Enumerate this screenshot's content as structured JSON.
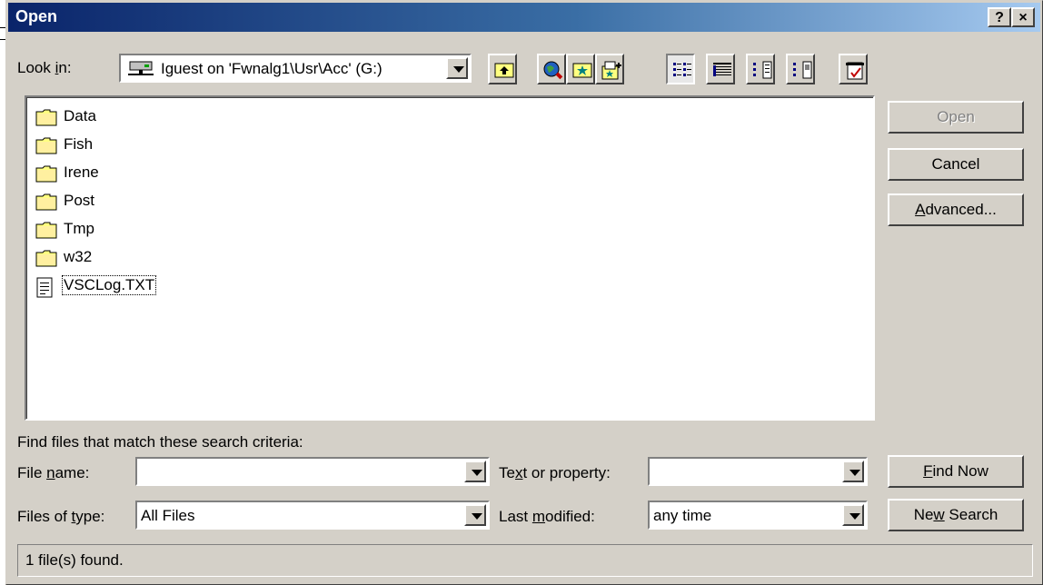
{
  "window": {
    "title": "Open",
    "help_label": "?",
    "close_label": "×"
  },
  "lookin": {
    "label_pre": "Look ",
    "label_accel": "i",
    "label_post": "n:",
    "value": "Iguest on 'Fwnalg1\\Usr\\Acc' (G:)"
  },
  "toolbar": [
    {
      "name": "up-one-level-icon"
    },
    {
      "name": "search-the-web-icon"
    },
    {
      "name": "look-in-favorites-icon"
    },
    {
      "name": "add-to-favorites-icon"
    },
    {
      "name": "list-view-icon"
    },
    {
      "name": "details-view-icon"
    },
    {
      "name": "properties-view-icon"
    },
    {
      "name": "preview-view-icon"
    },
    {
      "name": "commands-and-settings-icon"
    }
  ],
  "files": [
    {
      "name": "Data",
      "type": "folder"
    },
    {
      "name": "Fish",
      "type": "folder"
    },
    {
      "name": "Irene",
      "type": "folder"
    },
    {
      "name": "Post",
      "type": "folder"
    },
    {
      "name": "Tmp",
      "type": "folder"
    },
    {
      "name": "w32",
      "type": "folder"
    },
    {
      "name": "VSCLog.TXT",
      "type": "text"
    }
  ],
  "buttons": {
    "open": "Open",
    "cancel": "Cancel",
    "advanced_accel": "A",
    "advanced_rest": "dvanced...",
    "find_now_accel": "F",
    "find_now_rest": "ind Now",
    "new_search_pre": "Ne",
    "new_search_accel": "w",
    "new_search_post": " Search"
  },
  "criteria": {
    "heading": "Find files that match these search criteria:",
    "filename_pre": "File ",
    "filename_accel": "n",
    "filename_post": "ame:",
    "filename_value": "",
    "filetype_pre": "Files of ",
    "filetype_accel": "t",
    "filetype_post": "ype:",
    "filetype_value": "All Files",
    "text_pre": "Te",
    "text_accel": "x",
    "text_post": "t or property:",
    "text_value": "",
    "modified_pre": "Last ",
    "modified_accel": "m",
    "modified_post": "odified:",
    "modified_value": "any time"
  },
  "status": {
    "text": "1 file(s) found."
  }
}
